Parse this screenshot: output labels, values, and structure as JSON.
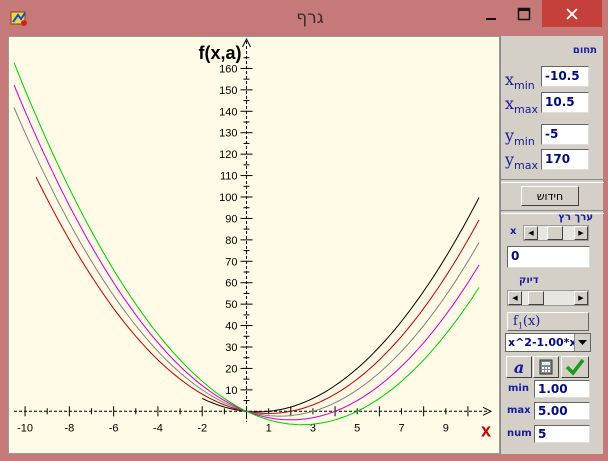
{
  "window": {
    "title": "גרף",
    "minimize_glyph": "—",
    "maximize_glyph": "☐",
    "close_glyph": "✕",
    "icon": "app-icon"
  },
  "panel": {
    "range_title": "תחום",
    "xmin_label": "x",
    "xmin_sub": "min",
    "xmin_value": "-10.5",
    "xmax_label": "x",
    "xmax_sub": "max",
    "xmax_value": "10.5",
    "ymin_label": "y",
    "ymin_sub": "min",
    "ymin_value": "-5",
    "ymax_label": "y",
    "ymax_sub": "max",
    "ymax_value": "170",
    "refresh_label": "חידוש",
    "cursor_title": "ערך רץ",
    "cursor_var": "x",
    "cursor_value": "0",
    "accuracy_title": "דיוק",
    "function_label": "f",
    "function_sub": "1",
    "function_arg": "(x)",
    "formula_value": "x^2-1.00*x",
    "param_symbol": "a",
    "min_label": "min",
    "min_value": "1.00",
    "max_label": "max",
    "max_value": "5.00",
    "num_label": "num",
    "num_value": "5"
  },
  "chart_data": {
    "type": "line",
    "ylabel": "f(x,a)",
    "xlabel": "x",
    "xlim": [
      -10.5,
      10.5
    ],
    "ylim": [
      -5,
      170
    ],
    "grid": false,
    "x_ticks": [
      -10,
      -8,
      -6,
      -4,
      -2,
      1,
      3,
      5,
      7,
      9
    ],
    "y_ticks": [
      10,
      20,
      30,
      40,
      50,
      60,
      70,
      80,
      90,
      100,
      110,
      120,
      130,
      140,
      150,
      160
    ],
    "series": [
      {
        "param_a": 1,
        "color": "#000000",
        "x": [
          -2,
          -1,
          0,
          1,
          2,
          4,
          6,
          8,
          10.5
        ],
        "y": [
          6,
          2,
          0,
          0,
          2,
          12,
          30,
          56,
          99.75
        ]
      },
      {
        "param_a": 2,
        "color": "#c00000",
        "x": [
          -9.5,
          -8,
          -6,
          -4,
          -2,
          0,
          2,
          4,
          6,
          8,
          10.5
        ],
        "y": [
          109.25,
          80,
          48,
          24,
          8,
          0,
          0,
          8,
          24,
          48,
          89.25
        ]
      },
      {
        "param_a": 3,
        "color": "#808080",
        "x": [
          -10.5,
          -8,
          -6,
          -4,
          -2,
          0,
          2,
          4,
          6,
          8,
          10.5
        ],
        "y": [
          141.75,
          88,
          54,
          28,
          10,
          0,
          -2,
          4,
          18,
          40,
          78.75
        ]
      },
      {
        "param_a": 4,
        "color": "#cc00cc",
        "x": [
          -10.5,
          -8,
          -6,
          -4,
          -2,
          0,
          2,
          4,
          6,
          8,
          10.5
        ],
        "y": [
          152.25,
          96,
          60,
          32,
          12,
          0,
          -4,
          0,
          12,
          32,
          68.25
        ]
      },
      {
        "param_a": 5,
        "color": "#00cc00",
        "x": [
          -10.5,
          -8,
          -6,
          -4,
          -2,
          0,
          2,
          4,
          6,
          8,
          10.5
        ],
        "y": [
          162.75,
          104,
          66,
          36,
          14,
          0,
          -6,
          -4,
          6,
          24,
          57.75
        ]
      }
    ]
  }
}
